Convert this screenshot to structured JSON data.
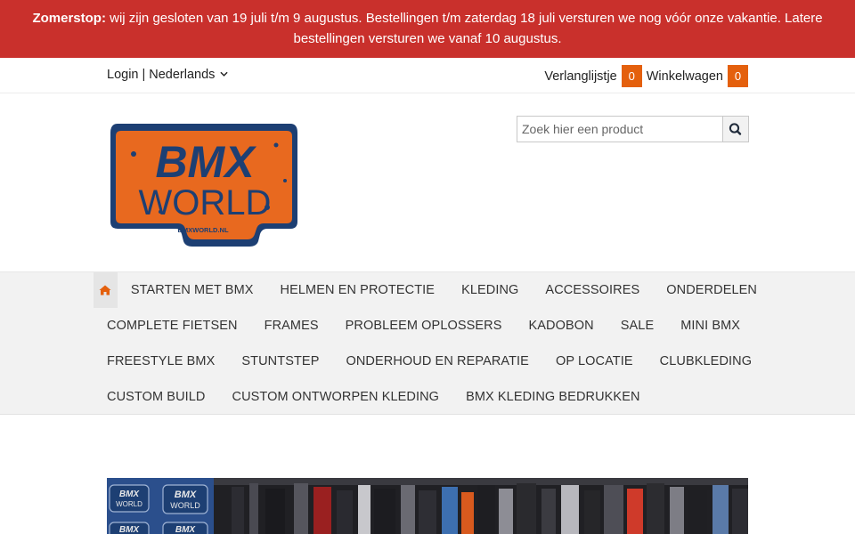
{
  "banner": {
    "bold": "Zomerstop:",
    "line1": " wij zijn gesloten van 19 juli t/m 9 augustus. Bestellingen t/m zaterdag 18 juli versturen we nog vóór onze vakantie. Latere",
    "line2": "bestellingen versturen we vanaf 10 augustus."
  },
  "topbar": {
    "login": "Login",
    "separator": "|",
    "language": "Nederlands",
    "wishlist_label": "Verlanglijstje",
    "wishlist_count": "0",
    "cart_label": "Winkelwagen",
    "cart_count": "0"
  },
  "logo": {
    "line1": "BMX",
    "line2": "WORLD",
    "small": "BMXWORLD.NL"
  },
  "search": {
    "placeholder": "Zoek hier een product",
    "icon": "search-icon"
  },
  "nav": {
    "home_icon": "home-icon",
    "rows": [
      [
        "STARTEN MET BMX",
        "HELMEN EN PROTECTIE",
        "KLEDING",
        "ACCESSOIRES",
        "ONDERDELEN"
      ],
      [
        "COMPLETE FIETSEN",
        "FRAMES",
        "PROBLEEM OPLOSSERS",
        "KADOBON",
        "SALE",
        "MINI BMX"
      ],
      [
        "FREESTYLE BMX",
        "STUNTSTEP",
        "ONDERHOUD EN REPARATIE",
        "OP LOCATIE",
        "CLUBKLEDING"
      ],
      [
        "CUSTOM BUILD",
        "CUSTOM ONTWORPEN KLEDING",
        "BMX KLEDING BEDRUKKEN"
      ]
    ]
  },
  "hero": {
    "tile_text_1": "BMX",
    "tile_text_2": "WORLD"
  },
  "colors": {
    "banner": "#c9302c",
    "accent": "#e4600d",
    "logo_blue": "#1d3f73",
    "logo_orange": "#e8691f"
  }
}
